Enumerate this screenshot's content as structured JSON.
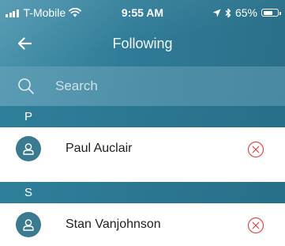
{
  "status_bar": {
    "carrier": "T-Mobile",
    "time": "9:55 AM",
    "battery_percent": "65%",
    "battery_level": 0.65
  },
  "nav": {
    "title": "Following"
  },
  "search": {
    "placeholder": "Search"
  },
  "sections": [
    {
      "letter": "P",
      "people": [
        {
          "name": "Paul Auclair"
        }
      ]
    },
    {
      "letter": "S",
      "people": [
        {
          "name": "Stan Vanjohnson"
        }
      ]
    }
  ],
  "colors": {
    "header": "#2f7c98",
    "section_header": "#2a7590",
    "avatar": "#3b7a90",
    "remove_icon": "#e84a4a"
  }
}
